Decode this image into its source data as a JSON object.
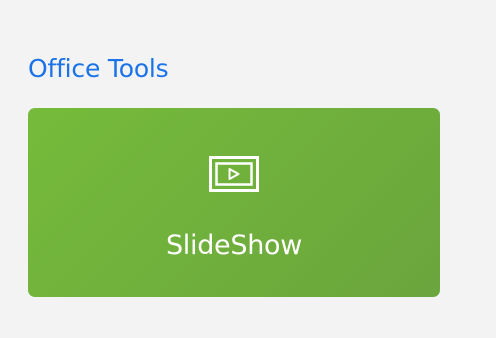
{
  "section": {
    "title": "Office Tools"
  },
  "tiles": [
    {
      "label": "SlideShow",
      "icon": "slideshow-play-icon"
    }
  ],
  "colors": {
    "title": "#1a73e8",
    "tile_background": "#6fb13c",
    "tile_text": "#ffffff",
    "page_background": "#f3f3f3"
  }
}
